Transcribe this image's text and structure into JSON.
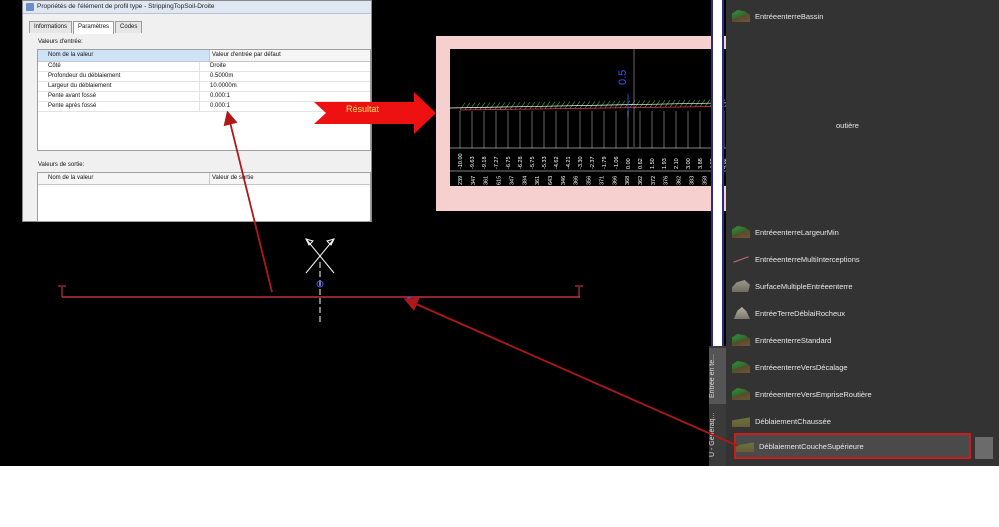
{
  "dialog": {
    "title": "Propriétés de l'élément de profil type - StrippingTopSoil-Droite",
    "tabs": [
      "Informations",
      "Paramètres",
      "Codes"
    ],
    "input_section_label": "Valeurs d'entrée:",
    "input_headers": {
      "name": "Nom de la valeur",
      "default": "Valeur d'entrée par défaut"
    },
    "input_rows": [
      {
        "name": "Côté",
        "value": "Droite"
      },
      {
        "name": "Profondeur du déblaiement",
        "value": "0.5000m"
      },
      {
        "name": "Largeur du déblaiement",
        "value": "10.0000m"
      },
      {
        "name": "Pente avant fossé",
        "value": "0.000:1"
      },
      {
        "name": "Pente après fossé",
        "value": "0.000:1"
      }
    ],
    "output_section_label": "Valeurs de sortie:",
    "output_headers": {
      "name": "Nom de la valeur",
      "output": "Valeur de sortie"
    }
  },
  "result_label": "Résultat",
  "result_view": {
    "dimension": "0.5",
    "offsets": [
      "-10.00",
      "-9.63",
      "-9.18",
      "-7.27",
      "-6.75",
      "-6.28",
      "-5.75",
      "-5.33",
      "-4.62",
      "-4.21",
      "-3.30",
      "-2.37",
      "-1.79",
      "-1.06",
      "0.00",
      "0.62",
      "1.50",
      "1.93",
      "2.10",
      "3.00",
      "3.88",
      "4.09",
      "4.62",
      "5.25",
      "6.84",
      "6.67",
      "7.46",
      "7.57",
      "8.12",
      "9.88",
      "10.00"
    ],
    "elevations": [
      "239",
      "347",
      "361",
      "615",
      "347",
      "384",
      "361",
      "643",
      "346",
      "366",
      "356",
      "371",
      "366",
      "368",
      "362",
      "372",
      "376",
      "362",
      "383",
      "358",
      "361",
      "343",
      "344",
      "351",
      "353",
      "358",
      "361",
      "348",
      "360"
    ]
  },
  "palette": {
    "items": [
      {
        "label": "EntréeenterreBassin",
        "icon": "green-terrain-icon"
      },
      {
        "label": "outière",
        "icon": "terrain-icon"
      },
      {
        "label": "EntréeenterreLargeurMin",
        "icon": "green-terrain-icon"
      },
      {
        "label": "EntréeenterreMultiInterceptions",
        "icon": "line-icon"
      },
      {
        "label": "SurfaceMultipleEntréeenterre",
        "icon": "gray-terrain-icon"
      },
      {
        "label": "EntréeTerreDéblaiRocheux",
        "icon": "rock-icon"
      },
      {
        "label": "EntréeenterreStandard",
        "icon": "green-terrain-icon"
      },
      {
        "label": "EntréeenterreVersDécalage",
        "icon": "green-terrain-icon"
      },
      {
        "label": "EntréeenterreVersEmpriseRoutière",
        "icon": "green-terrain-icon"
      },
      {
        "label": "DéblaiementChaussée",
        "icon": "brown-terrain-icon"
      },
      {
        "label": "DéblaiementCoucheSupérieure",
        "icon": "brown-terrain-icon"
      }
    ],
    "vertical_tabs": [
      "Entrée en te...",
      "U - Généraq..."
    ]
  },
  "colors": {
    "canvas": "#000000",
    "palette": "#333333",
    "highlight": "#c81e1e",
    "result_border": "#f6cfcf"
  }
}
